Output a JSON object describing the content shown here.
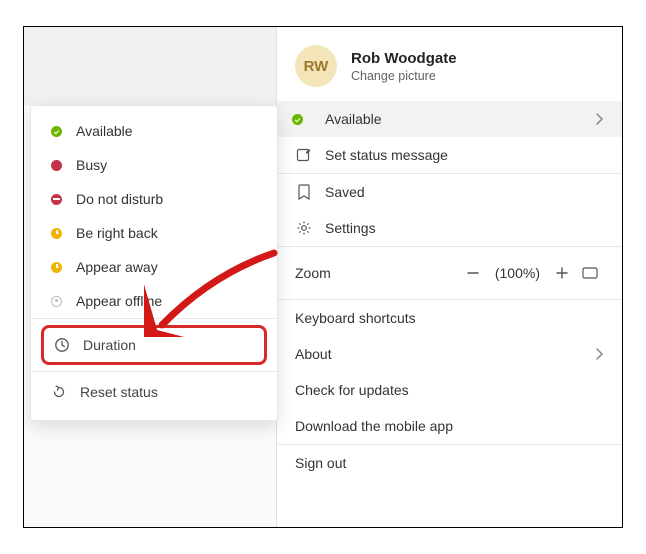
{
  "profile": {
    "initials": "RW",
    "name": "Rob Woodgate",
    "change_picture": "Change picture"
  },
  "main_menu": {
    "available": "Available",
    "set_status": "Set status message",
    "saved": "Saved",
    "settings": "Settings",
    "zoom_label": "Zoom",
    "zoom_pct": "(100%)",
    "shortcuts": "Keyboard shortcuts",
    "about": "About",
    "updates": "Check for updates",
    "download": "Download the mobile app",
    "signout": "Sign out"
  },
  "status_menu": {
    "available": "Available",
    "busy": "Busy",
    "dnd": "Do not disturb",
    "brb": "Be right back",
    "away": "Appear away",
    "offline": "Appear offline",
    "duration": "Duration",
    "reset": "Reset status"
  }
}
